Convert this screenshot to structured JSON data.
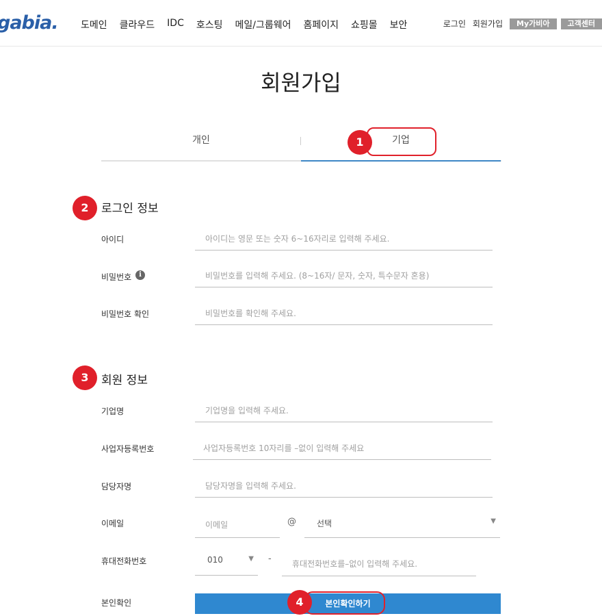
{
  "header": {
    "logo": "gabia.",
    "nav": [
      "도메인",
      "클라우드",
      "IDC",
      "호스팅",
      "메일/그룹웨어",
      "홈페이지",
      "쇼핑몰",
      "보안"
    ],
    "util_links": [
      "로그인",
      "회원가입"
    ],
    "util_buttons": [
      "My가비아",
      "고객센터"
    ]
  },
  "page_title": "회원가입",
  "tabs": {
    "personal": "개인",
    "business": "기업"
  },
  "markers": [
    "1",
    "2",
    "3",
    "4"
  ],
  "login_section": {
    "title": "로그인 정보",
    "id_label": "아이디",
    "id_placeholder": "아이디는 영문 또는 숫자 6~16자리로 입력해 주세요.",
    "pw_label": "비밀번호",
    "pw_placeholder": "비밀번호를 입력해 주세요. (8~16자/ 문자, 숫자, 특수문자 혼용)",
    "pw_confirm_label": "비밀번호 확인",
    "pw_confirm_placeholder": "비밀번호를 확인해 주세요."
  },
  "member_section": {
    "title": "회원 정보",
    "company_label": "기업명",
    "company_placeholder": "기업명을 입력해 주세요.",
    "bizno_label": "사업자등록번호",
    "bizno_placeholder": "사업자등록번호 10자리를 –없이 입력해 주세요",
    "manager_label": "담당자명",
    "manager_placeholder": "담당자명을 입력해 주세요.",
    "email_label": "이메일",
    "email_placeholder": "이메일",
    "email_at": "@",
    "email_domain_selected": "선택",
    "phone_label": "휴대전화번호",
    "phone_prefix_selected": "010",
    "phone_dash": "-",
    "phone_placeholder": "휴대전화번호를–없이 입력해 주세요.",
    "verify_label": "본인확인",
    "verify_button": "본인확인하기"
  },
  "colors": {
    "accent": "#2f88d0",
    "marker": "#e0202a",
    "logo": "#2a5fa8"
  }
}
